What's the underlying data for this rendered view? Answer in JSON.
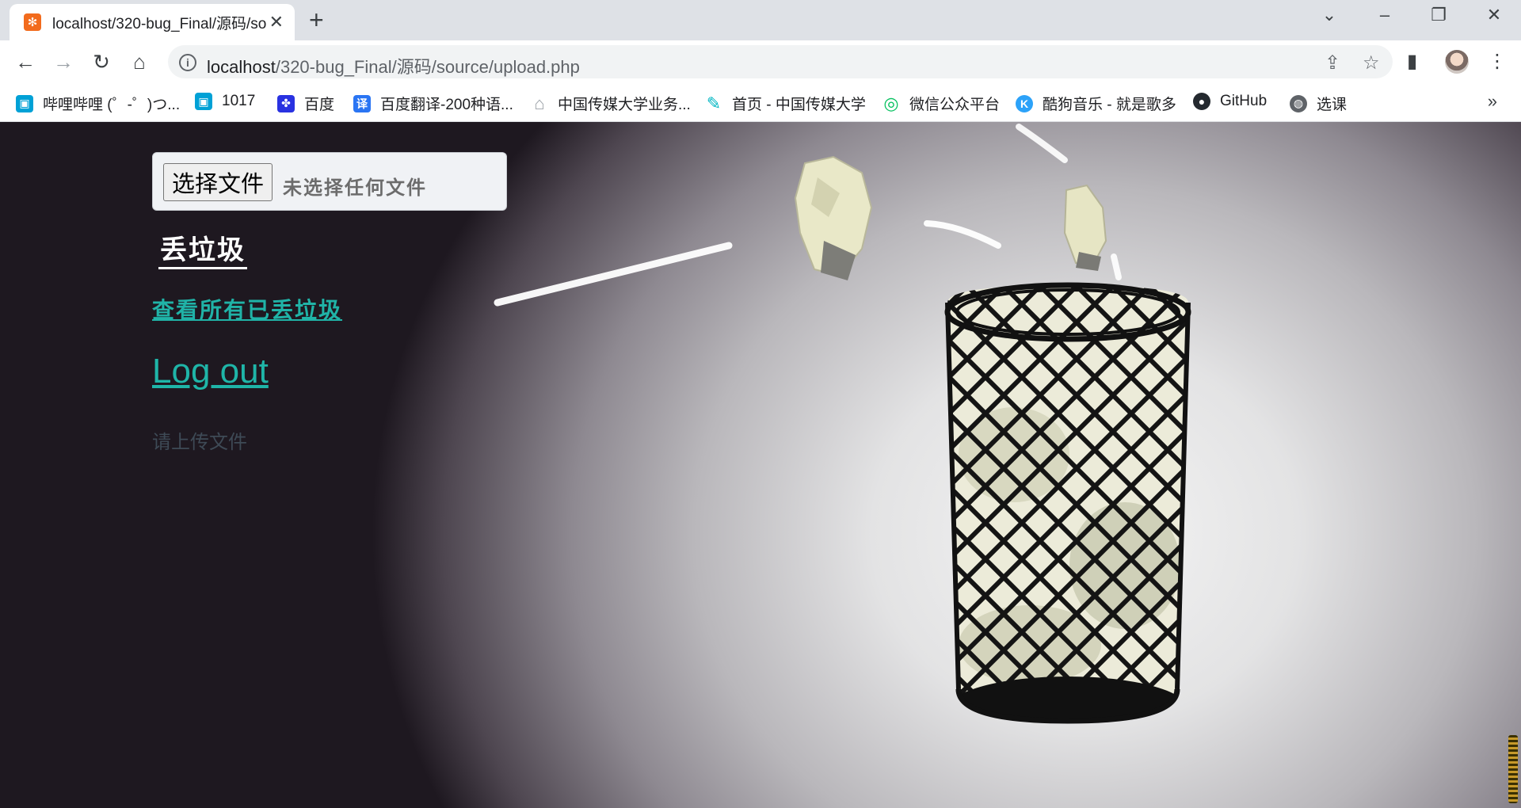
{
  "browser": {
    "tab": {
      "title": "localhost/320-bug_Final/源码/source/upload.php",
      "favicon_color": "#f26b1d"
    },
    "address": {
      "host": "localhost",
      "path": "/320-bug_Final/源码/source/upload.php"
    },
    "bookmarks": [
      {
        "label": "哔哩哔哩 (゜-゜)つ...",
        "icon": "bilibili-icon",
        "color": "#00a1d6"
      },
      {
        "label": "1017",
        "icon": "bilibili-icon",
        "color": "#00a1d6"
      },
      {
        "label": "百度",
        "icon": "baidu-icon",
        "color": "#2932e1"
      },
      {
        "label": "百度翻译-200种语...",
        "icon": "translate-icon",
        "color": "#2a75f3"
      },
      {
        "label": "中国传媒大学业务...",
        "icon": "home-icon",
        "color": "#9aa0a6"
      },
      {
        "label": "首页 - 中国传媒大学",
        "icon": "cuc-icon",
        "color": "#00b6c3"
      },
      {
        "label": "微信公众平台",
        "icon": "wechat-icon",
        "color": "#07c160"
      },
      {
        "label": "酷狗音乐 - 就是歌多",
        "icon": "kugou-icon",
        "color": "#2ca2f9"
      },
      {
        "label": "GitHub",
        "icon": "github-icon",
        "color": "#24292f"
      },
      {
        "label": "选课",
        "icon": "globe-icon",
        "color": "#5f6368"
      }
    ]
  },
  "page": {
    "choose_file_label": "选择文件",
    "no_file_text": "未选择任何文件",
    "heading": "丢垃圾",
    "view_all_link": "查看所有已丢垃圾",
    "logout_link": "Log out",
    "message": "请上传文件"
  },
  "colors": {
    "link": "#1fb5a8",
    "message": "#3e4a56"
  }
}
